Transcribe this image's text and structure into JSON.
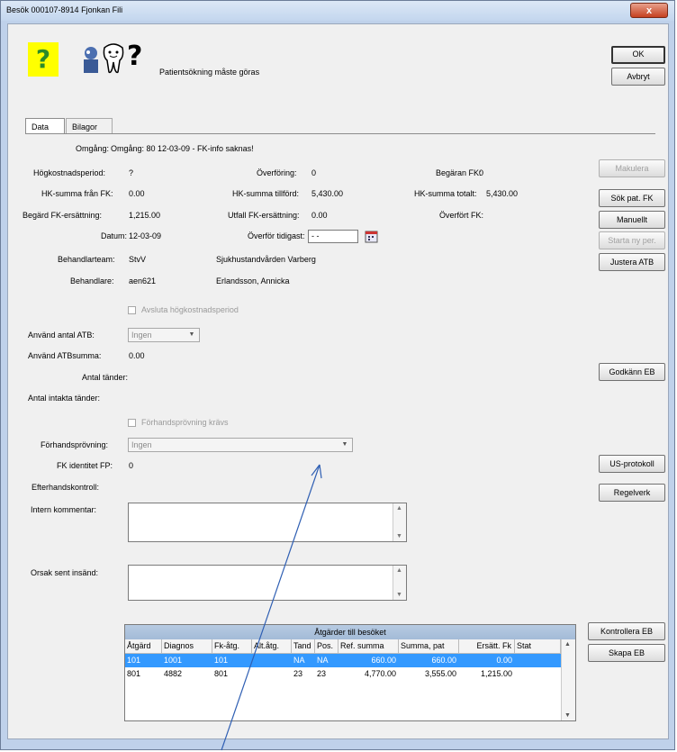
{
  "window": {
    "title": "Besök 000107-8914 Fjonkan Fili",
    "close": "x"
  },
  "header": {
    "help_glyph": "?",
    "message": "Patientsökning måste göras",
    "icon_question": "?"
  },
  "tabs": [
    {
      "label": "Data"
    },
    {
      "label": "Bilagor"
    }
  ],
  "buttons": {
    "ok": "OK",
    "cancel": "Avbryt",
    "makulera": "Makulera",
    "sok_pat_fk": "Sök pat. FK",
    "manuellt": "Manuellt",
    "starta_ny_per": "Starta ny per.",
    "justera_atb": "Justera ATB",
    "godkann_eb": "Godkänn EB",
    "us_protokoll": "US-protokoll",
    "regelverk": "Regelverk",
    "kontrollera_eb": "Kontrollera EB",
    "skapa_eb": "Skapa EB"
  },
  "form": {
    "omgang_label": "Omgång:",
    "omgang_value": "Omgång: 80 12-03-09 - FK-info saknas!",
    "hkp_label": "Högkostnadsperiod:",
    "hkp_value": "?",
    "overforing_label": "Överföring:",
    "overforing_value": "0",
    "begaran_label": "Begäran FK:",
    "begaran_value": "0",
    "hk_fran_fk_label": "HK-summa från FK:",
    "hk_fran_fk_value": "0.00",
    "hk_tillford_label": "HK-summa tillförd:",
    "hk_tillford_value": "5,430.00",
    "hk_totalt_label": "HK-summa totalt:",
    "hk_totalt_value": "5,430.00",
    "begard_label": "Begärd FK-ersättning:",
    "begard_value": "1,215.00",
    "utfall_label": "Utfall FK-ersättning:",
    "utfall_value": "0.00",
    "overfort_label": "Överfört FK:",
    "datum_label": "Datum:",
    "datum_value": "12-03-09",
    "overfor_tidigast_label": "Överför tidigast:",
    "overfor_tidigast_value": "- -",
    "behandlarteam_label": "Behandlarteam:",
    "behandlarteam_code": "StvV",
    "behandlarteam_name": "Sjukhustandvården Varberg",
    "behandlare_label": "Behandlare:",
    "behandlare_code": "aen621",
    "behandlare_name": "Erlandsson, Annicka",
    "avsluta_label": "Avsluta högkostnadsperiod",
    "anvand_antal_label": "Använd antal ATB:",
    "anvand_antal_value": "Ingen",
    "anvand_summa_label": "Använd ATBsumma:",
    "anvand_summa_value": "0.00",
    "antal_tander_label": "Antal tänder:",
    "antal_intakta_label": "Antal intakta tänder:",
    "forhandsprovning_kravs_label": "Förhandsprövning krävs",
    "forhandsprovning_label": "Förhandsprövning:",
    "forhandsprovning_value": "Ingen",
    "fk_identitet_label": "FK identitet FP:",
    "fk_identitet_value": "0",
    "efterhandskontroll_label": "Efterhandskontroll:",
    "intern_kommentar_label": "Intern kommentar:",
    "orsak_sent_label": "Orsak sent insänd:"
  },
  "grid": {
    "title": "Åtgärder till besöket",
    "columns": [
      "Åtgärd",
      "Diagnos",
      "Fk-åtg.",
      "Alt.åtg.",
      "Tand",
      "Pos.",
      "Ref. summa",
      "Summa, pat",
      "Ersätt. Fk",
      "Stat"
    ],
    "rows": [
      [
        "101",
        "1001",
        "101",
        "",
        "NA",
        "NA",
        "660.00",
        "660.00",
        "0.00",
        ""
      ],
      [
        "801",
        "4882",
        "801",
        "",
        "23",
        "23",
        "4,770.00",
        "3,555.00",
        "1,215.00",
        ""
      ]
    ]
  },
  "colors": {
    "selection": "#3399ff",
    "titlebar": "#c3d6ee",
    "help_bg": "#ffff00",
    "annotation_arrow": "#2f5fb3"
  }
}
